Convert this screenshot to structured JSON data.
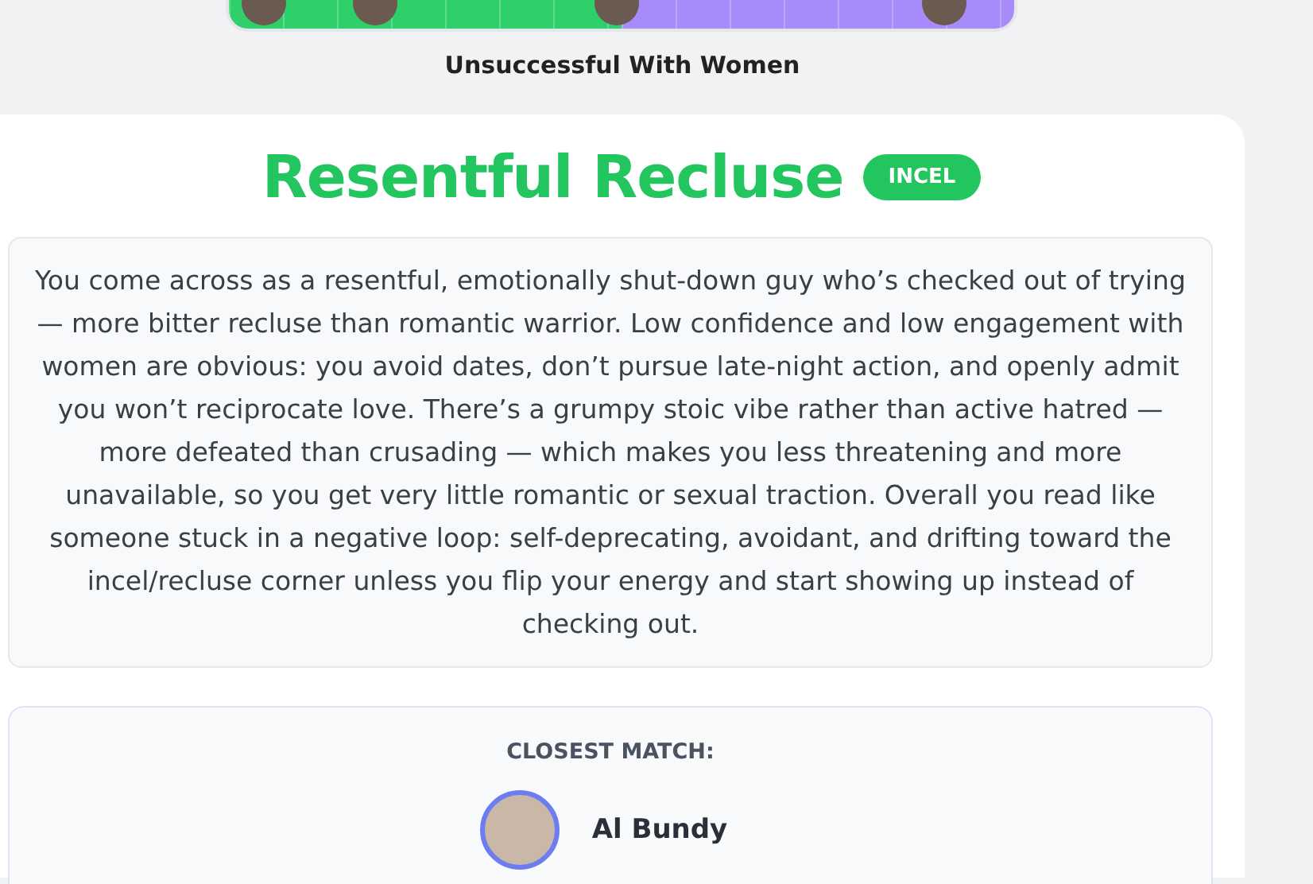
{
  "category": {
    "label": "Unsuccessful With Women"
  },
  "result": {
    "title": "Resentful Recluse",
    "badge": "INCEL",
    "description": "You come across as a resentful, emotionally shut-down guy who’s checked out of trying — more bitter recluse than romantic warrior. Low confidence and low engagement with women are obvious: you avoid dates, don’t pursue late-night action, and openly admit you won’t reciprocate love. There’s a grumpy stoic vibe rather than active hatred — more defeated than crusading — which makes you less threatening and more unavailable, so you get very little romantic or sexual traction. Overall you read like someone stuck in a negative loop: self-deprecating, avoidant, and drifting toward the incel/recluse corner unless you flip your energy and start showing up instead of checking out."
  },
  "closest_match": {
    "heading": "CLOSEST MATCH:",
    "name": "Al Bundy"
  }
}
